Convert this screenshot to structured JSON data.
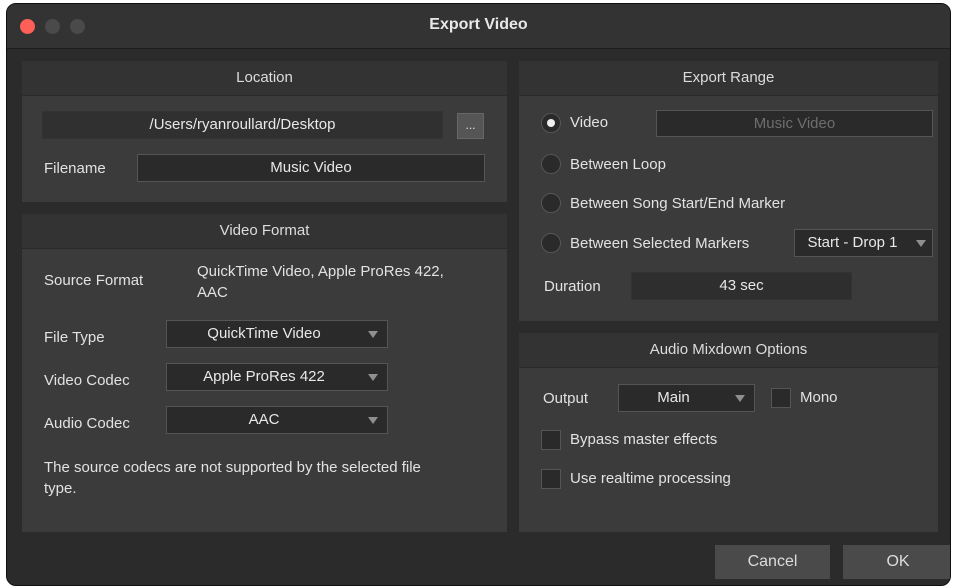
{
  "window": {
    "title": "Export Video"
  },
  "location": {
    "header": "Location",
    "path": "/Users/ryanroullard/Desktop",
    "browse_label": "...",
    "filename_label": "Filename",
    "filename_value": "Music Video"
  },
  "video_format": {
    "header": "Video Format",
    "source_format_label": "Source Format",
    "source_format_value_line1": "QuickTime Video, Apple ProRes 422,",
    "source_format_value_line2": "AAC",
    "file_type_label": "File Type",
    "file_type_value": "QuickTime Video",
    "video_codec_label": "Video Codec",
    "video_codec_value": "Apple ProRes 422",
    "audio_codec_label": "Audio Codec",
    "audio_codec_value": "AAC",
    "warning_line1": "The source codecs are not supported by the selected file",
    "warning_line2": "type."
  },
  "export_range": {
    "header": "Export Range",
    "options": [
      {
        "label": "Video",
        "selected": true
      },
      {
        "label": "Between Loop",
        "selected": false
      },
      {
        "label": "Between Song Start/End Marker",
        "selected": false
      },
      {
        "label": "Between Selected Markers",
        "selected": false
      }
    ],
    "video_name_value": "Music Video",
    "markers_value": "Start - Drop 1",
    "duration_label": "Duration",
    "duration_value": "43 sec"
  },
  "audio_mixdown": {
    "header": "Audio Mixdown Options",
    "output_label": "Output",
    "output_value": "Main",
    "mono_label": "Mono",
    "mono_checked": false,
    "bypass_label": "Bypass master effects",
    "bypass_checked": false,
    "realtime_label": "Use realtime processing",
    "realtime_checked": false
  },
  "footer": {
    "cancel_label": "Cancel",
    "ok_label": "OK"
  },
  "colors": {
    "close": "#fe5f57",
    "panel": "#3b3b3b",
    "background": "#2b2b2b"
  }
}
